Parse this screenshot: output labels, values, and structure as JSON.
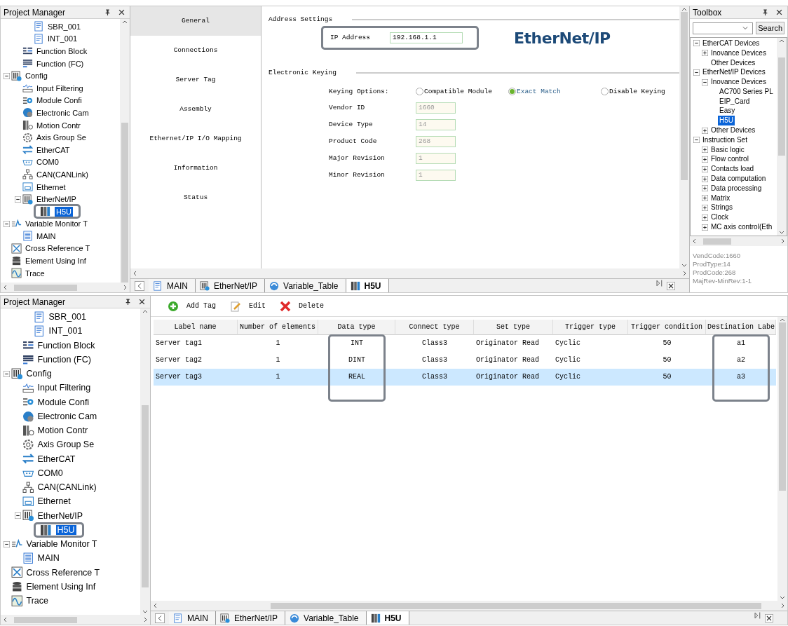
{
  "top_view": {
    "project_manager": {
      "title": "Project Manager",
      "tree": [
        {
          "children": [
            {
              "children": [
                {
                  "label": "SBR_001",
                  "kind": "program",
                  "selected": false
                },
                {
                  "label": "INT_001",
                  "kind": "program",
                  "selected": false
                }
              ]
            },
            {
              "label": "Function Block",
              "kind": "block",
              "selected": false
            },
            {
              "label": "Function (FC)",
              "kind": "function",
              "selected": false
            }
          ]
        },
        {
          "label": "Config",
          "kind": "config",
          "selected": false,
          "expanded": true,
          "children": [
            {
              "label": "Input Filtering",
              "kind": "filter",
              "selected": false
            },
            {
              "label": "Module Confi",
              "kind": "module",
              "selected": false
            },
            {
              "label": "Electronic Cam",
              "kind": "cam",
              "selected": false
            },
            {
              "label": "Motion Contr",
              "kind": "motion",
              "selected": false
            },
            {
              "label": "Axis Group Se",
              "kind": "axis",
              "selected": false
            },
            {
              "label": "EtherCAT",
              "kind": "ethercat",
              "selected": false
            },
            {
              "label": "COM0",
              "kind": "serial",
              "selected": false
            },
            {
              "label": "CAN(CANLink)",
              "kind": "can",
              "selected": false
            },
            {
              "label": "Ethernet",
              "kind": "ethernet",
              "selected": false
            },
            {
              "label": "EtherNet/IP",
              "kind": "config",
              "selected": false,
              "expanded": true,
              "children": [
                {
                  "label": "H5U",
                  "kind": "device",
                  "selected": true,
                  "outlined": true
                }
              ]
            }
          ]
        },
        {
          "label": "Variable Monitor T",
          "kind": "monitor",
          "selected": false,
          "expanded": true,
          "children": [
            {
              "label": "MAIN",
              "kind": "doc",
              "selected": false
            }
          ]
        },
        {
          "label": "Cross Reference T",
          "kind": "xref",
          "selected": false
        },
        {
          "label": "Element Using Inf",
          "kind": "database",
          "selected": false
        },
        {
          "label": "Trace",
          "kind": "trace",
          "selected": false
        }
      ]
    },
    "editor": {
      "nav": [
        {
          "label": "General",
          "selected": true
        },
        {
          "label": "Connections",
          "selected": false
        },
        {
          "label": "Server Tag",
          "selected": false
        },
        {
          "label": "Assembly",
          "selected": false
        },
        {
          "label": "Ethernet/IP I/O Mapping",
          "selected": false
        },
        {
          "label": "Information",
          "selected": false
        },
        {
          "label": "Status",
          "selected": false
        }
      ],
      "address_settings": {
        "title": "Address Settings",
        "ip_label": "IP Address",
        "ip_value": "192.168.1.1",
        "outlined": true,
        "logo": "EtherNet/IP"
      },
      "electronic_keying": {
        "title": "Electronic Keying",
        "options_label": "Keying Options:",
        "options": [
          {
            "label": "Compatible Module",
            "selected": false
          },
          {
            "label": "Exact Match",
            "selected": true
          },
          {
            "label": "Disable Keying",
            "selected": false
          }
        ],
        "fields": [
          {
            "label": "Vendor ID",
            "value": "1660",
            "disabled": true
          },
          {
            "label": "Device Type",
            "value": "14",
            "disabled": true
          },
          {
            "label": "Product Code",
            "value": "268",
            "disabled": true
          },
          {
            "label": "Major Revision",
            "value": "1",
            "disabled": true
          },
          {
            "label": "Minor Revision",
            "value": "1",
            "disabled": true
          }
        ]
      }
    },
    "tabs": [
      {
        "label": "MAIN",
        "kind": "program",
        "selected": false
      },
      {
        "label": "EtherNet/IP",
        "kind": "config",
        "selected": false
      },
      {
        "label": "Variable_Table",
        "kind": "table",
        "selected": false
      },
      {
        "label": "H5U",
        "kind": "device",
        "selected": true
      }
    ],
    "toolbox": {
      "title": "Toolbox",
      "search_button": "Search",
      "tree": [
        {
          "label": "EtherCAT Devices",
          "selected": false,
          "expanded": true,
          "children": [
            {
              "label": "Inovance Devices",
              "selected": false,
              "expanded": false
            },
            {
              "label": "Other Devices",
              "selected": false
            }
          ]
        },
        {
          "label": "EtherNet/IP Devices",
          "selected": false,
          "expanded": true,
          "children": [
            {
              "label": "Inovance Devices",
              "selected": false,
              "expanded": true,
              "children": [
                {
                  "label": "AC700 Series PL",
                  "selected": false
                },
                {
                  "label": "EIP_Card",
                  "selected": false
                },
                {
                  "label": "Easy",
                  "selected": false
                },
                {
                  "label": "H5U",
                  "selected": true
                }
              ]
            },
            {
              "label": "Other Devices",
              "selected": false,
              "expanded": false
            }
          ]
        },
        {
          "label": "Instruction Set",
          "selected": false,
          "expanded": true,
          "children": [
            {
              "label": "Basic logic",
              "selected": false,
              "expanded": false
            },
            {
              "label": "Flow control",
              "selected": false,
              "expanded": false
            },
            {
              "label": "Contacts load",
              "selected": false,
              "expanded": false
            },
            {
              "label": "Data computation",
              "selected": false,
              "expanded": false
            },
            {
              "label": "Data processing",
              "selected": false,
              "expanded": false
            },
            {
              "label": "Matrix",
              "selected": false,
              "expanded": false
            },
            {
              "label": "Strings",
              "selected": false,
              "expanded": false
            },
            {
              "label": "Clock",
              "selected": false,
              "expanded": false
            },
            {
              "label": "MC axis control(Eth",
              "selected": false,
              "expanded": false
            }
          ]
        }
      ],
      "info": [
        "VendCode:1660",
        "ProdType:14",
        "ProdCode:268",
        "MajRev-MinRev:1-1"
      ]
    }
  },
  "bottom_view": {
    "project_manager": {
      "title": "Project Manager",
      "tree": [
        {
          "children": [
            {
              "children": [
                {
                  "label": "SBR_001",
                  "kind": "program",
                  "selected": false
                },
                {
                  "label": "INT_001",
                  "kind": "program",
                  "selected": false
                }
              ]
            },
            {
              "label": "Function Block",
              "kind": "block",
              "selected": false
            },
            {
              "label": "Function (FC)",
              "kind": "function",
              "selected": false
            }
          ]
        },
        {
          "label": "Config",
          "kind": "config",
          "selected": false,
          "expanded": true,
          "children": [
            {
              "label": "Input Filtering",
              "kind": "filter",
              "selected": false
            },
            {
              "label": "Module Confi",
              "kind": "module",
              "selected": false
            },
            {
              "label": "Electronic Cam",
              "kind": "cam",
              "selected": false
            },
            {
              "label": "Motion Contr",
              "kind": "motion",
              "selected": false
            },
            {
              "label": "Axis Group Se",
              "kind": "axis",
              "selected": false
            },
            {
              "label": "EtherCAT",
              "kind": "ethercat",
              "selected": false
            },
            {
              "label": "COM0",
              "kind": "serial",
              "selected": false
            },
            {
              "label": "CAN(CANLink)",
              "kind": "can",
              "selected": false
            },
            {
              "label": "Ethernet",
              "kind": "ethernet",
              "selected": false
            },
            {
              "label": "EtherNet/IP",
              "kind": "config",
              "selected": false,
              "expanded": true,
              "children": [
                {
                  "label": "H5U",
                  "kind": "device",
                  "selected": true,
                  "outlined": true
                }
              ]
            }
          ]
        },
        {
          "label": "Variable Monitor T",
          "kind": "monitor",
          "selected": false,
          "expanded": true,
          "children": [
            {
              "label": "MAIN",
              "kind": "doc",
              "selected": false
            }
          ]
        },
        {
          "label": "Cross Reference T",
          "kind": "xref",
          "selected": false
        },
        {
          "label": "Element Using Inf",
          "kind": "database",
          "selected": false
        },
        {
          "label": "Trace",
          "kind": "trace",
          "selected": false
        }
      ]
    },
    "toolbar": [
      {
        "label": "Add Tag",
        "kind": "add"
      },
      {
        "label": "Edit",
        "kind": "edit"
      },
      {
        "label": "Delete",
        "kind": "delete"
      }
    ],
    "table": {
      "columns": [
        {
          "label": "Label name",
          "outlined": false
        },
        {
          "label": "Number of elements",
          "outlined": false
        },
        {
          "label": "Data type",
          "outlined": true
        },
        {
          "label": "Connect type",
          "outlined": false
        },
        {
          "label": "Set type",
          "outlined": false
        },
        {
          "label": "Trigger type",
          "outlined": false
        },
        {
          "label": "Trigger condition",
          "outlined": false
        },
        {
          "label": "Destination Labe",
          "outlined": true
        }
      ],
      "rows": [
        {
          "cells": [
            "Server tag1",
            "1",
            "INT",
            "Class3",
            "Originator Read",
            "Cyclic",
            "50",
            "a1"
          ],
          "selected": false
        },
        {
          "cells": [
            "Server tag2",
            "1",
            "DINT",
            "Class3",
            "Originator Read",
            "Cyclic",
            "50",
            "a2"
          ],
          "selected": false
        },
        {
          "cells": [
            "Server tag3",
            "1",
            "REAL",
            "Class3",
            "Originator Read",
            "Cyclic",
            "50",
            "a3"
          ],
          "selected": true
        }
      ]
    },
    "tabs": [
      {
        "label": "MAIN",
        "kind": "program",
        "selected": false
      },
      {
        "label": "EtherNet/IP",
        "kind": "config",
        "selected": false
      },
      {
        "label": "Variable_Table",
        "kind": "table",
        "selected": false
      },
      {
        "label": "H5U",
        "kind": "device",
        "selected": true
      }
    ]
  }
}
